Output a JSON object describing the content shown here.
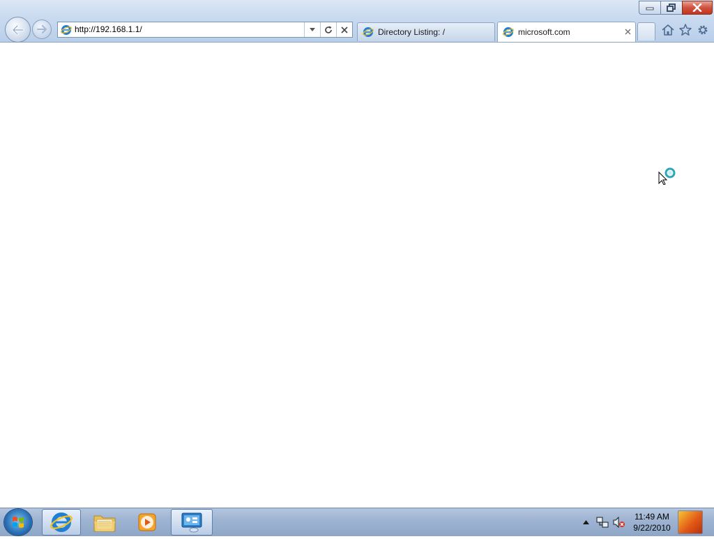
{
  "window": {
    "controls": {
      "minimize_icon": "minimize-icon",
      "restore_icon": "restore-icon",
      "close_icon": "close-icon"
    }
  },
  "navigation": {
    "back_icon": "back-arrow-icon",
    "forward_icon": "forward-arrow-icon"
  },
  "address_bar": {
    "url": "http://192.168.1.1/",
    "dropdown_icon": "chevron-down-icon",
    "refresh_icon": "refresh-icon",
    "stop_icon": "stop-icon"
  },
  "tabs": [
    {
      "label": "Directory Listing: /",
      "active": false,
      "icon": "ie-page-icon"
    },
    {
      "label": "microsoft.com",
      "active": true,
      "icon": "ie-page-icon",
      "close_icon": "close-icon"
    }
  ],
  "command_bar": {
    "home_icon": "home-icon",
    "favorites_icon": "star-icon",
    "tools_icon": "gear-icon"
  },
  "content": {
    "cursor": "busy-pointer-icon"
  },
  "taskbar": {
    "start_icon": "windows-logo-icon",
    "pinned": [
      {
        "name": "internet-explorer",
        "icon": "internet-explorer-icon",
        "active": true
      },
      {
        "name": "windows-explorer",
        "icon": "folder-icon",
        "active": false
      },
      {
        "name": "windows-media-player",
        "icon": "media-player-icon",
        "active": false
      },
      {
        "name": "remote-desktop",
        "icon": "remote-desktop-icon",
        "active": true
      }
    ],
    "tray": {
      "show_hidden_icon": "chevron-up-icon",
      "network_icon": "network-icon",
      "volume_icon": "volume-muted-icon"
    },
    "clock": {
      "time": "11:49 AM",
      "date": "9/22/2010"
    }
  },
  "colors": {
    "chrome_top": "#dbe7f5",
    "chrome_bottom": "#b9cfe9",
    "close_button": "#c2361f",
    "taskbar": "#9fb4d2",
    "ie_blue": "#1f7fd6",
    "ie_ring": "#f4c21b"
  }
}
